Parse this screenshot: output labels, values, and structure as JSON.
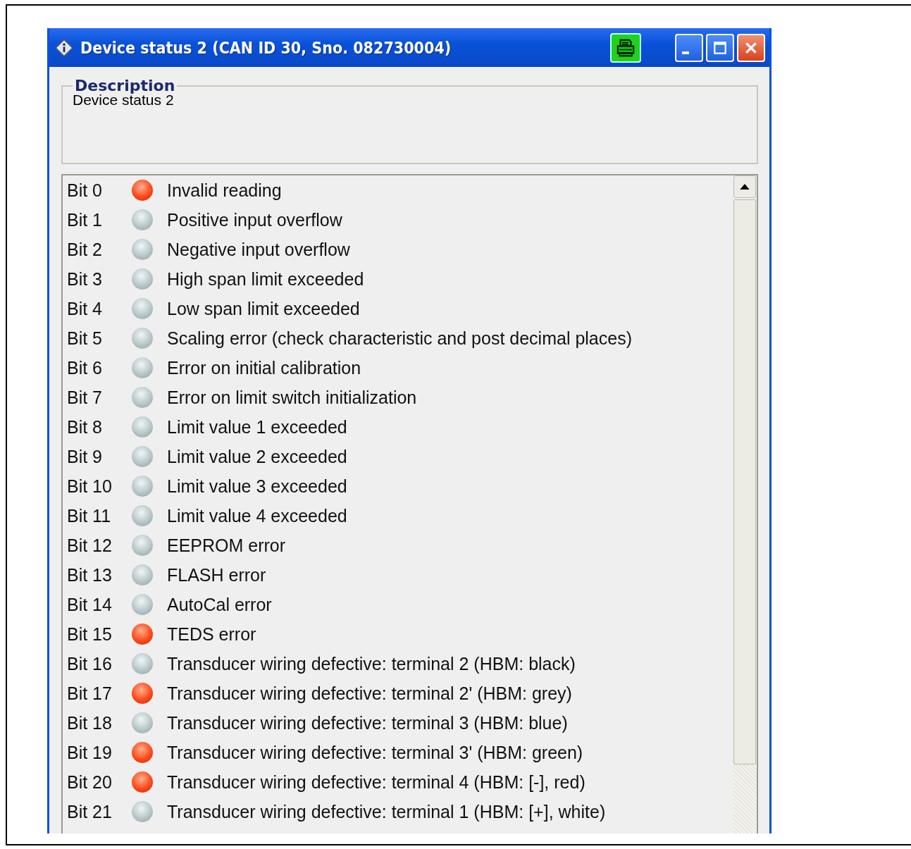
{
  "window": {
    "title": "Device status 2 (CAN ID 30, Sno. 082730004)"
  },
  "description": {
    "legend": "Description",
    "text": "Device status 2"
  },
  "bits": [
    {
      "bit": "Bit 0",
      "on": true,
      "label": "Invalid reading"
    },
    {
      "bit": "Bit 1",
      "on": false,
      "label": "Positive input overflow"
    },
    {
      "bit": "Bit 2",
      "on": false,
      "label": "Negative input overflow"
    },
    {
      "bit": "Bit 3",
      "on": false,
      "label": "High span limit exceeded"
    },
    {
      "bit": "Bit 4",
      "on": false,
      "label": "Low span limit exceeded"
    },
    {
      "bit": "Bit 5",
      "on": false,
      "label": "Scaling error (check characteristic and post decimal places)"
    },
    {
      "bit": "Bit 6",
      "on": false,
      "label": "Error on initial calibration"
    },
    {
      "bit": "Bit 7",
      "on": false,
      "label": "Error on limit switch initialization"
    },
    {
      "bit": "Bit 8",
      "on": false,
      "label": "Limit value 1 exceeded"
    },
    {
      "bit": "Bit 9",
      "on": false,
      "label": "Limit value 2 exceeded"
    },
    {
      "bit": "Bit 10",
      "on": false,
      "label": "Limit value 3 exceeded"
    },
    {
      "bit": "Bit 11",
      "on": false,
      "label": "Limit value 4 exceeded"
    },
    {
      "bit": "Bit 12",
      "on": false,
      "label": "EEPROM error"
    },
    {
      "bit": "Bit 13",
      "on": false,
      "label": "FLASH error"
    },
    {
      "bit": "Bit 14",
      "on": false,
      "label": "AutoCal error"
    },
    {
      "bit": "Bit 15",
      "on": true,
      "label": "TEDS error"
    },
    {
      "bit": "Bit 16",
      "on": false,
      "label": "Transducer wiring defective: terminal 2 (HBM: black)"
    },
    {
      "bit": "Bit 17",
      "on": true,
      "label": "Transducer wiring defective: terminal 2' (HBM: grey)"
    },
    {
      "bit": "Bit 18",
      "on": false,
      "label": "Transducer wiring defective: terminal 3 (HBM: blue)"
    },
    {
      "bit": "Bit 19",
      "on": true,
      "label": "Transducer wiring defective: terminal 3' (HBM: green)"
    },
    {
      "bit": "Bit 20",
      "on": true,
      "label": "Transducer wiring defective: terminal 4 (HBM: [-], red)"
    },
    {
      "bit": "Bit 21",
      "on": false,
      "label": "Transducer wiring defective: terminal 1 (HBM: [+], white)"
    }
  ]
}
